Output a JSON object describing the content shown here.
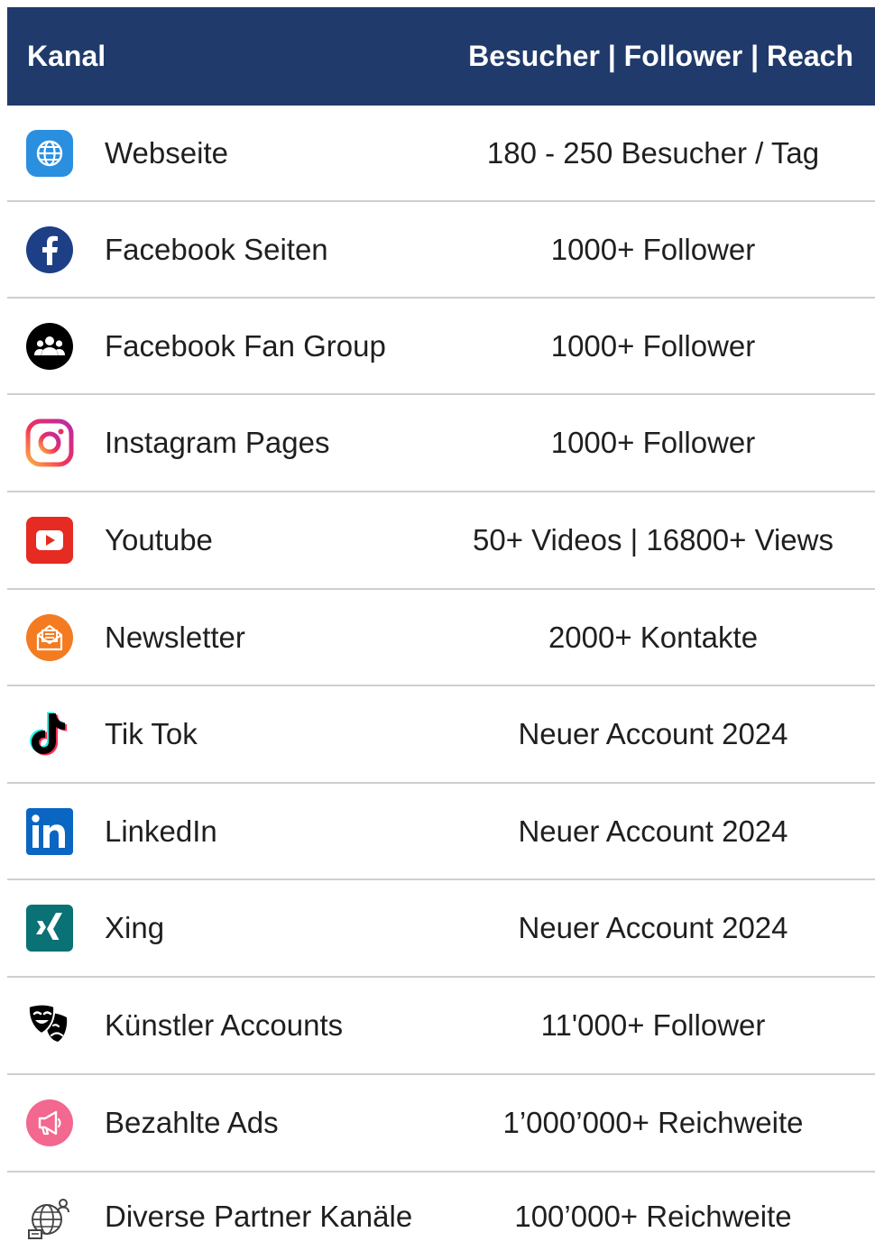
{
  "header": {
    "col_kanal": "Kanal",
    "col_metrics": "Besucher | Follower  | Reach",
    "background_color": "#203a6b"
  },
  "rows": [
    {
      "icon": "globe-icon",
      "name": "Webseite",
      "value": "180 - 250 Besucher / Tag"
    },
    {
      "icon": "facebook-icon",
      "name": "Facebook Seiten",
      "value": "1000+ Follower"
    },
    {
      "icon": "group-icon",
      "name": "Facebook Fan Group",
      "value": "1000+ Follower"
    },
    {
      "icon": "instagram-icon",
      "name": "Instagram Pages",
      "value": "1000+ Follower"
    },
    {
      "icon": "youtube-icon",
      "name": "Youtube",
      "value": "50+ Videos | 16800+ Views"
    },
    {
      "icon": "newsletter-icon",
      "name": "Newsletter",
      "value": "2000+ Kontakte"
    },
    {
      "icon": "tiktok-icon",
      "name": "Tik Tok",
      "value": "Neuer Account 2024"
    },
    {
      "icon": "linkedin-icon",
      "name": "LinkedIn",
      "value": "Neuer Account 2024"
    },
    {
      "icon": "xing-icon",
      "name": "Xing",
      "value": "Neuer Account 2024"
    },
    {
      "icon": "theater-masks-icon",
      "name": "Künstler Accounts",
      "value": "11'000+ Follower"
    },
    {
      "icon": "megaphone-icon",
      "name": "Bezahlte Ads",
      "value": "1’000’000+ Reichweite"
    },
    {
      "icon": "partner-network-icon",
      "name": "Diverse Partner Kanäle",
      "value": "100’000+ Reichweite"
    }
  ]
}
